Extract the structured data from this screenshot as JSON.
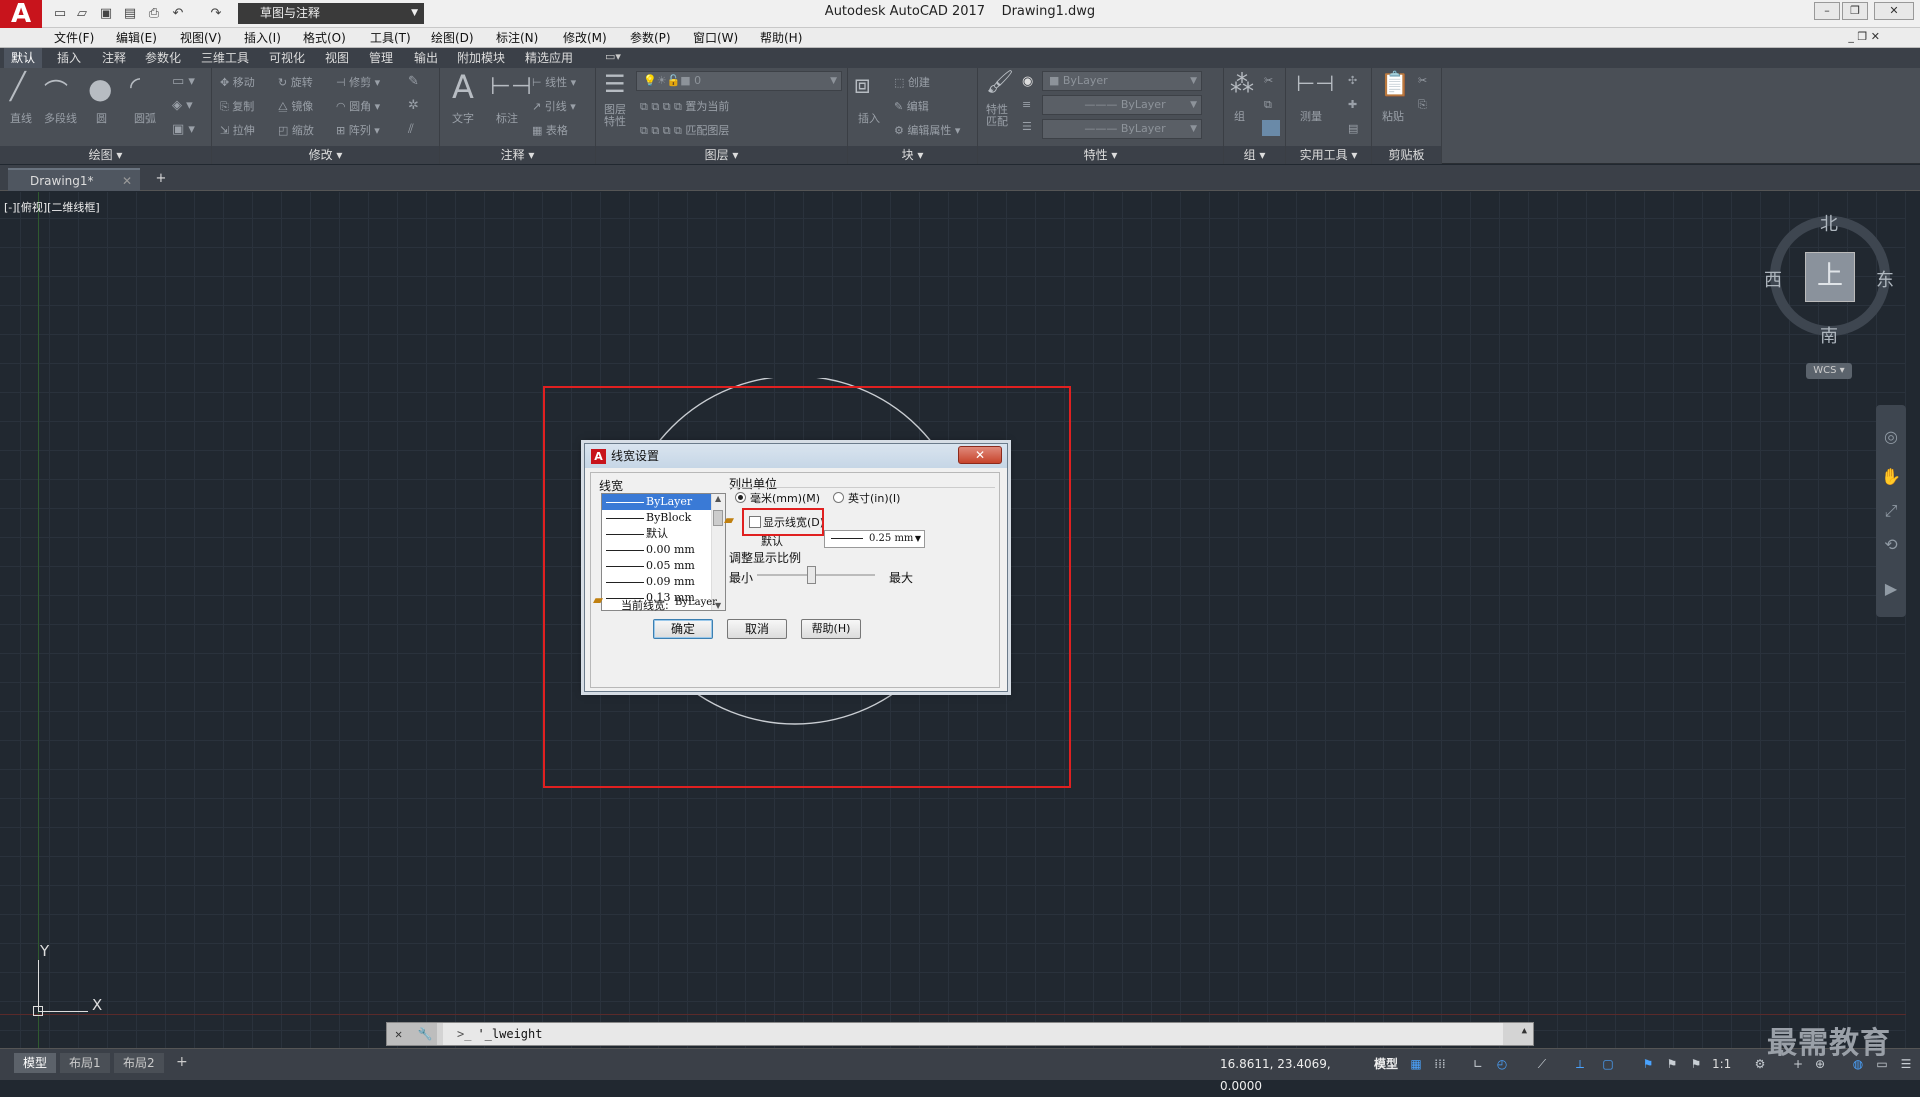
{
  "app": {
    "title": "Autodesk AutoCAD 2017",
    "filename": "Drawing1.dwg",
    "workspace": "草图与注释",
    "logo_letter": "A"
  },
  "menubar": [
    "文件(F)",
    "编辑(E)",
    "视图(V)",
    "插入(I)",
    "格式(O)",
    "工具(T)",
    "绘图(D)",
    "标注(N)",
    "修改(M)",
    "参数(P)",
    "窗口(W)",
    "帮助(H)"
  ],
  "ribbon_tabs": [
    "默认",
    "插入",
    "注释",
    "参数化",
    "三维工具",
    "可视化",
    "视图",
    "管理",
    "输出",
    "附加模块",
    "精选应用"
  ],
  "ribbon": {
    "draw": {
      "title": "绘图",
      "items": [
        "直线",
        "多段线",
        "圆",
        "圆弧"
      ]
    },
    "modify": {
      "title": "修改",
      "items": [
        "移动",
        "旋转",
        "修剪",
        "复制",
        "镜像",
        "圆角",
        "拉伸",
        "缩放",
        "阵列"
      ]
    },
    "annotation": {
      "title": "注释",
      "items": [
        "文字",
        "标注",
        "线性",
        "引线",
        "表格"
      ]
    },
    "layers": {
      "title": "图层",
      "layer_value": "0",
      "items": [
        "图层特性",
        "置为当前",
        "匹配图层"
      ]
    },
    "block": {
      "title": "块",
      "items": [
        "插入",
        "创建",
        "编辑",
        "编辑属性"
      ]
    },
    "properties": {
      "title": "特性",
      "combo1": "ByLayer",
      "combo2": "ByLayer",
      "combo3": "ByLayer",
      "items": [
        "特性匹配"
      ]
    },
    "groups": {
      "title": "组",
      "items": [
        "组"
      ]
    },
    "utilities": {
      "title": "实用工具",
      "items": [
        "测量"
      ]
    },
    "clipboard": {
      "title": "剪贴板",
      "items": [
        "粘贴"
      ]
    }
  },
  "doc_tab": "Drawing1*",
  "viewport_label": "[-][俯视][二维线框]",
  "viewcube": {
    "north": "北",
    "south": "南",
    "east": "东",
    "west": "西",
    "top": "上",
    "wcs": "WCS"
  },
  "ucs": {
    "x": "X",
    "y": "Y"
  },
  "dialog": {
    "title": "线宽设置",
    "close": "✕",
    "lineweights_label": "线宽",
    "lineweights": [
      "ByLayer",
      "ByBlock",
      "默认",
      "0.00 mm",
      "0.05 mm",
      "0.09 mm",
      "0.13 mm"
    ],
    "selected_index": 0,
    "units_label": "列出单位",
    "unit_mm": "毫米(mm)(M)",
    "unit_in": "英寸(in)(I)",
    "unit_selected": "mm",
    "display_lw_label": "显示线宽(D)",
    "display_lw_checked": false,
    "default_label": "默认",
    "default_value": "0.25 mm",
    "scale_label": "调整显示比例",
    "scale_min": "最小",
    "scale_max": "最大",
    "current_label": "当前线宽:",
    "current_value": "ByLayer",
    "ok": "确定",
    "cancel": "取消",
    "help": "帮助(H)"
  },
  "command_line": {
    "text": "'_lweight",
    "prompt_icon": ">_"
  },
  "layout_tabs": [
    "模型",
    "布局1",
    "布局2"
  ],
  "status": {
    "coords": "16.8611, 23.4069, 0.0000",
    "model": "模型",
    "scale": "1:1"
  },
  "watermark": "最需教育",
  "colors": {
    "highlight": "#e02020",
    "background": "#212830",
    "ribbon": "#4a4f56",
    "brand": "#c8141c"
  }
}
